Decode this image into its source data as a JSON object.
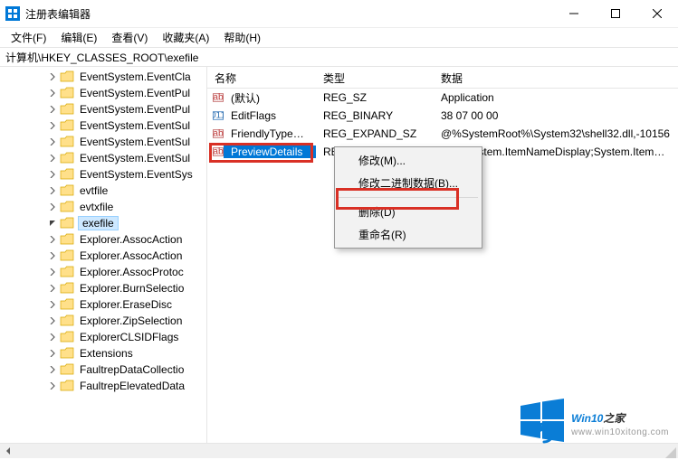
{
  "window": {
    "title": "注册表编辑器"
  },
  "menu": {
    "file": "文件(F)",
    "edit": "编辑(E)",
    "view": "查看(V)",
    "favorites": "收藏夹(A)",
    "help": "帮助(H)"
  },
  "address": "计算机\\HKEY_CLASSES_ROOT\\exefile",
  "tree": {
    "items": [
      {
        "l": "EventSystem.EventCla",
        "d": 3,
        "e": "r"
      },
      {
        "l": "EventSystem.EventPul",
        "d": 3,
        "e": "r"
      },
      {
        "l": "EventSystem.EventPul",
        "d": 3,
        "e": "r"
      },
      {
        "l": "EventSystem.EventSul",
        "d": 3,
        "e": "r"
      },
      {
        "l": "EventSystem.EventSul",
        "d": 3,
        "e": "r"
      },
      {
        "l": "EventSystem.EventSul",
        "d": 3,
        "e": "r"
      },
      {
        "l": "EventSystem.EventSys",
        "d": 3,
        "e": "r"
      },
      {
        "l": "evtfile",
        "d": 3,
        "e": "r"
      },
      {
        "l": "evtxfile",
        "d": 3,
        "e": "r"
      },
      {
        "l": "exefile",
        "d": 3,
        "e": "d",
        "sel": true
      },
      {
        "l": "Explorer.AssocAction",
        "d": 3,
        "e": "r"
      },
      {
        "l": "Explorer.AssocAction",
        "d": 3,
        "e": "r"
      },
      {
        "l": "Explorer.AssocProtoc",
        "d": 3,
        "e": "r"
      },
      {
        "l": "Explorer.BurnSelectio",
        "d": 3,
        "e": "r"
      },
      {
        "l": "Explorer.EraseDisc",
        "d": 3,
        "e": "r"
      },
      {
        "l": "Explorer.ZipSelection",
        "d": 3,
        "e": "r"
      },
      {
        "l": "ExplorerCLSIDFlags",
        "d": 3,
        "e": "r"
      },
      {
        "l": "Extensions",
        "d": 3,
        "e": "r"
      },
      {
        "l": "FaultrepDataCollectio",
        "d": 3,
        "e": "r"
      },
      {
        "l": "FaultrepElevatedData",
        "d": 3,
        "e": "r"
      }
    ]
  },
  "list": {
    "headers": {
      "name": "名称",
      "type": "类型",
      "data": "数据"
    },
    "rows": [
      {
        "icon": "ab",
        "name": "(默认)",
        "type": "REG_SZ",
        "data": "Application"
      },
      {
        "icon": "bin",
        "name": "EditFlags",
        "type": "REG_BINARY",
        "data": "38 07 00 00"
      },
      {
        "icon": "ab",
        "name": "FriendlyTypeN...",
        "type": "REG_EXPAND_SZ",
        "data": "@%SystemRoot%\\System32\\shell32.dll,-10156"
      },
      {
        "icon": "ab",
        "name": "PreviewDetails",
        "type": "REG_SZ",
        "data": "prop:System.ItemNameDisplay;System.ItemTy...",
        "sel": true
      }
    ]
  },
  "contextmenu": {
    "modify": "修改(M)...",
    "modify_binary": "修改二进制数据(B)...",
    "delete": "删除(D)",
    "rename": "重命名(R)"
  },
  "watermark": {
    "brand_big_1": "Win10",
    "brand_big_2": "之家",
    "url": "www.win10xitong.com"
  }
}
